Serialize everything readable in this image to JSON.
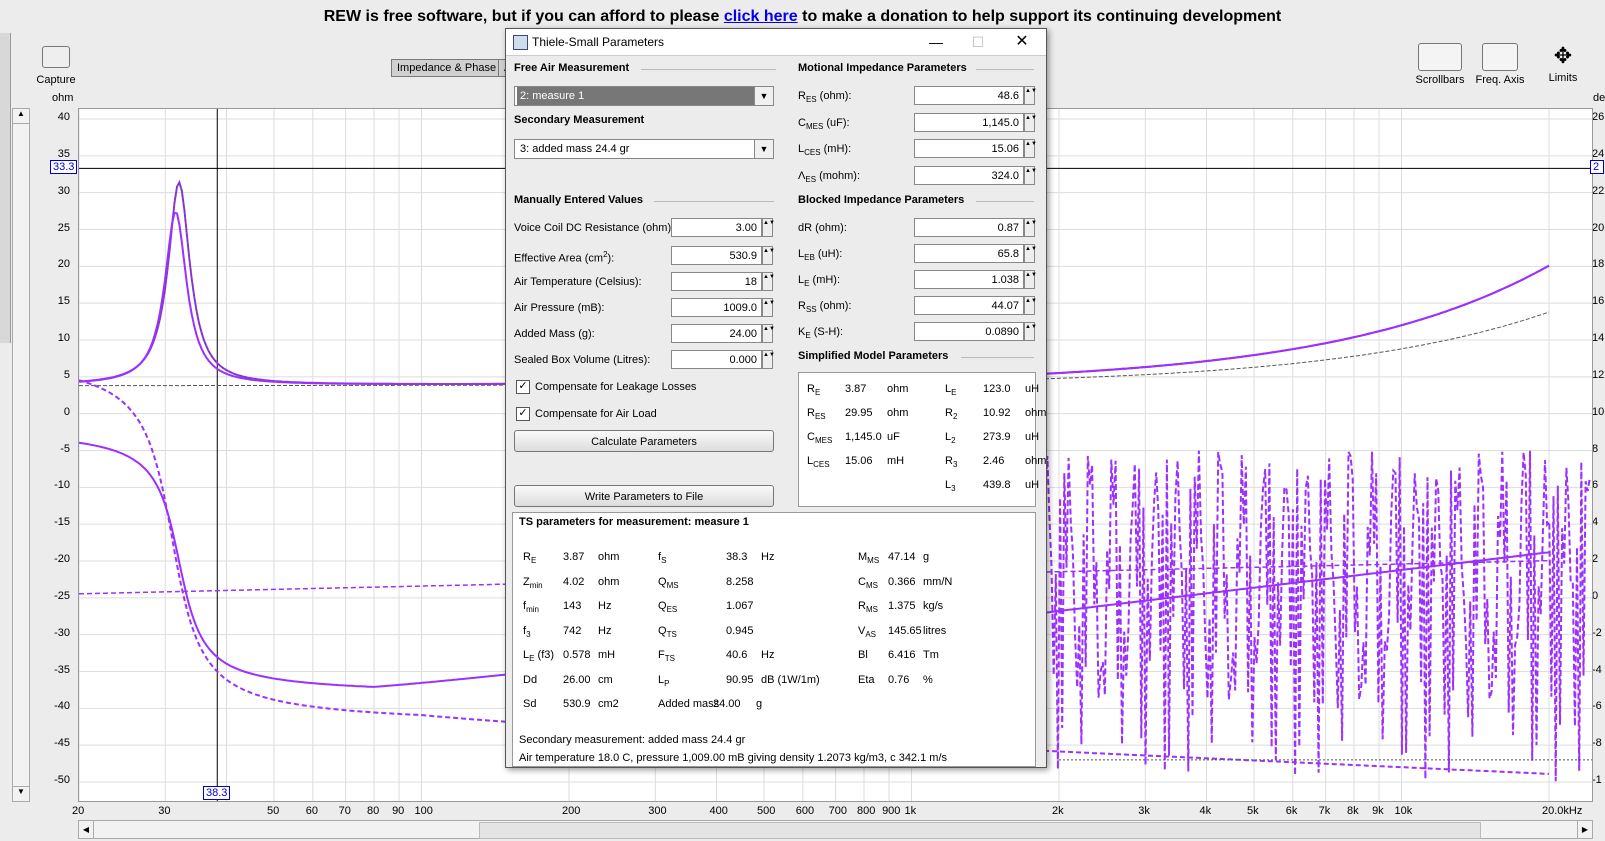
{
  "banner": {
    "pre": "REW is free software, but if you can afford to please",
    "link": "click here",
    "post": "to make a donation to help support its continuing development"
  },
  "toolbar": {
    "capture": "Capture",
    "scrollbars": "Scrollbars",
    "freq_axis": "Freq. Axis",
    "limits": "Limits",
    "unit_left": "ohm",
    "tab_impedance": "Impedance & Phase",
    "tab_partial": "A"
  },
  "graph": {
    "y_ticks_left": [
      "40",
      "35",
      "30",
      "25",
      "20",
      "15",
      "10",
      "5",
      "0",
      "-5",
      "-10",
      "-15",
      "-20",
      "-25",
      "-30",
      "-35",
      "-40",
      "-45",
      "-50"
    ],
    "y_ticks_right": [
      "26",
      "24",
      "22",
      "20",
      "18",
      "16",
      "14",
      "12",
      "10",
      "8",
      "6",
      "4",
      "2",
      "0",
      "-2",
      "-4",
      "-6",
      "-8",
      "-1"
    ],
    "x_ticks": [
      "20",
      "30",
      "50",
      "60",
      "70",
      "80",
      "90",
      "100",
      "200",
      "300",
      "400",
      "500",
      "600",
      "700",
      "800",
      "900",
      "1k",
      "2k",
      "3k",
      "4k",
      "5k",
      "6k",
      "7k",
      "8k",
      "9k",
      "10k",
      "20.0kHz"
    ],
    "cursor_y": "33.3",
    "cursor_x": "38.3",
    "right_partial": "de",
    "right_cursor": "2"
  },
  "dialog": {
    "title": "Thiele-Small Parameters",
    "free_air": {
      "heading": "Free Air Measurement",
      "value": "2: measure 1"
    },
    "secondary": {
      "heading": "Secondary Measurement",
      "value": "3: added mass 24.4 gr"
    },
    "manual": {
      "heading": "Manually Entered Values",
      "rows": [
        {
          "label": "Voice Coil DC Resistance (ohm):",
          "value": "3.00"
        },
        {
          "label": "Effective Area (cm",
          "sup": "2",
          "label_end": "):",
          "value": "530.9"
        },
        {
          "label": "Air Temperature (Celsius):",
          "value": "18"
        },
        {
          "label": "Air Pressure (mB):",
          "value": "1009.0"
        },
        {
          "label": "Added Mass (g):",
          "value": "24.00"
        },
        {
          "label": "Sealed Box Volume (Litres):",
          "value": "0.000"
        }
      ],
      "leakage": "Compensate for Leakage Losses",
      "airload": "Compensate for Air Load",
      "calc": "Calculate Parameters",
      "write": "Write Parameters to File"
    },
    "motional": {
      "heading": "Motional Impedance Parameters",
      "rows": [
        {
          "sym": "R",
          "sub": "ES",
          "unit": " (ohm):",
          "value": "48.6"
        },
        {
          "sym": "C",
          "sub": "MES",
          "unit": " (uF):",
          "value": "1,145.0"
        },
        {
          "sym": "L",
          "sub": "CES",
          "unit": " (mH):",
          "value": "15.06"
        },
        {
          "sym": "Λ",
          "sub": "ES",
          "unit": " (mohm):",
          "value": "324.0"
        }
      ]
    },
    "blocked": {
      "heading": "Blocked Impedance Parameters",
      "rows": [
        {
          "sym": "dR",
          "sub": "",
          "unit": " (ohm):",
          "value": "0.87"
        },
        {
          "sym": "L",
          "sub": "EB",
          "unit": " (uH):",
          "value": "65.8"
        },
        {
          "sym": "L",
          "sub": "E",
          "unit": " (mH):",
          "value": "1.038"
        },
        {
          "sym": "R",
          "sub": "SS",
          "unit": " (ohm):",
          "value": "44.07"
        },
        {
          "sym": "K",
          "sub": "E",
          "unit": " (S-H):",
          "value": "0.0890"
        }
      ]
    },
    "simplified": {
      "heading": "Simplified Model Parameters",
      "left": [
        {
          "sym": "R",
          "sub": "E",
          "val": "3.87",
          "unit": "ohm"
        },
        {
          "sym": "R",
          "sub": "ES",
          "val": "29.95",
          "unit": "ohm"
        },
        {
          "sym": "C",
          "sub": "MES",
          "val": "1,145.0",
          "unit": "uF"
        },
        {
          "sym": "L",
          "sub": "CES",
          "val": "15.06",
          "unit": "mH"
        }
      ],
      "right": [
        {
          "sym": "L",
          "sub": "E",
          "val": "123.0",
          "unit": "uH"
        },
        {
          "sym": "R",
          "sub": "2",
          "val": "10.92",
          "unit": "ohm"
        },
        {
          "sym": "L",
          "sub": "2",
          "val": "273.9",
          "unit": "uH"
        },
        {
          "sym": "R",
          "sub": "3",
          "val": "2.46",
          "unit": "ohm"
        },
        {
          "sym": "L",
          "sub": "3",
          "val": "439.8",
          "unit": "uH"
        }
      ]
    },
    "ts": {
      "heading": "TS parameters for measurement: measure 1",
      "col1": [
        {
          "sym": "R",
          "sub": "E",
          "val": "3.87",
          "unit": "ohm"
        },
        {
          "sym": "Z",
          "sub": "min",
          "val": "4.02",
          "unit": "ohm"
        },
        {
          "sym": "f",
          "sub": "min",
          "val": "143",
          "unit": "Hz"
        },
        {
          "sym": "f",
          "sub": "3",
          "val": "742",
          "unit": "Hz"
        },
        {
          "sym": "L",
          "sub": "E",
          "extra": " (f3)",
          "val": "0.578",
          "unit": "mH"
        },
        {
          "sym": "Dd",
          "sub": "",
          "val": "26.00",
          "unit": "cm"
        },
        {
          "sym": "Sd",
          "sub": "",
          "val": "530.9",
          "unit": "cm2"
        }
      ],
      "col2": [
        {
          "sym": "f",
          "sub": "S",
          "val": "38.3",
          "unit": "Hz"
        },
        {
          "sym": "Q",
          "sub": "MS",
          "val": "8.258",
          "unit": ""
        },
        {
          "sym": "Q",
          "sub": "ES",
          "val": "1.067",
          "unit": ""
        },
        {
          "sym": "Q",
          "sub": "TS",
          "val": "0.945",
          "unit": ""
        },
        {
          "sym": "F",
          "sub": "TS",
          "val": "40.6",
          "unit": "Hz"
        },
        {
          "sym": "L",
          "sub": "P",
          "val": "90.95",
          "unit": "dB (1W/1m)"
        },
        {
          "sym": "Added mass",
          "sub": "",
          "val": "24.00",
          "unit": "g"
        }
      ],
      "col3": [
        {
          "sym": "M",
          "sub": "MS",
          "val": "47.14",
          "unit": "g"
        },
        {
          "sym": "C",
          "sub": "MS",
          "val": "0.366",
          "unit": "mm/N"
        },
        {
          "sym": "R",
          "sub": "MS",
          "val": "1.375",
          "unit": "kg/s"
        },
        {
          "sym": "V",
          "sub": "AS",
          "val": "145.65",
          "unit": "litres"
        },
        {
          "sym": "Bl",
          "sub": "",
          "val": "6.416",
          "unit": "Tm"
        },
        {
          "sym": "Eta",
          "sub": "",
          "val": "0.76",
          "unit": "%"
        }
      ],
      "footer1": "Secondary measurement: added mass 24.4 gr",
      "footer2": "Air temperature 18.0 C, pressure 1,009.00 mB giving density 1.2073 kg/m3, c 342.1 m/s"
    }
  }
}
